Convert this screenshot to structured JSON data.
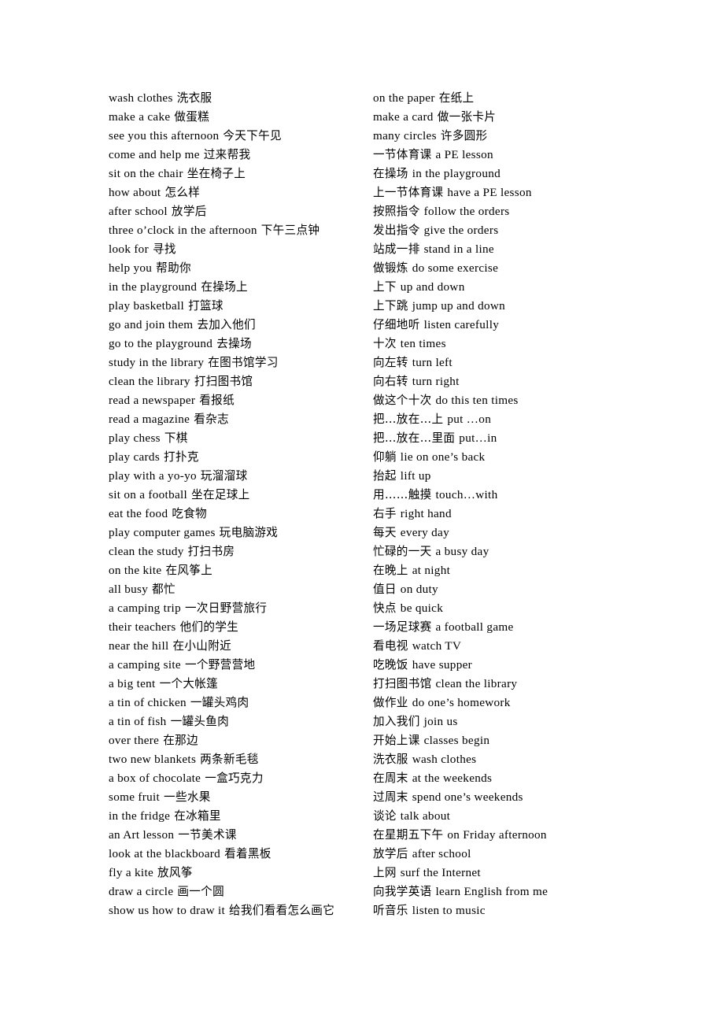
{
  "document": {
    "background_color": "#ffffff",
    "text_color": "#000000",
    "columns": [
      {
        "id": "left-column",
        "order": "english-first",
        "entries": [
          {
            "term": "wash clothes",
            "gloss": "洗衣服"
          },
          {
            "term": "make a cake",
            "gloss": "做蛋糕"
          },
          {
            "term": "see you this afternoon",
            "gloss": "今天下午见"
          },
          {
            "term": "come and help me",
            "gloss": "过来帮我"
          },
          {
            "term": "sit on the chair",
            "gloss": "坐在椅子上"
          },
          {
            "term": "how about",
            "gloss": "怎么样"
          },
          {
            "term": "after school",
            "gloss": "放学后"
          },
          {
            "term": "three o’clock in the afternoon",
            "gloss": "下午三点钟"
          },
          {
            "term": "look for",
            "gloss": "寻找"
          },
          {
            "term": "help you",
            "gloss": "帮助你"
          },
          {
            "term": "in the playground",
            "gloss": "在操场上"
          },
          {
            "term": "play basketball",
            "gloss": "打篮球"
          },
          {
            "term": "go and join them",
            "gloss": "去加入他们"
          },
          {
            "term": "go to the playground",
            "gloss": "去操场"
          },
          {
            "term": "study in the library",
            "gloss": "在图书馆学习"
          },
          {
            "term": "clean the library",
            "gloss": "打扫图书馆"
          },
          {
            "term": "read a newspaper",
            "gloss": "看报纸"
          },
          {
            "term": "read a magazine",
            "gloss": "看杂志"
          },
          {
            "term": "play chess",
            "gloss": "下棋"
          },
          {
            "term": "play cards",
            "gloss": "打扑克"
          },
          {
            "term": "play with a yo-yo",
            "gloss": "玩溜溜球"
          },
          {
            "term": "sit on a football",
            "gloss": "坐在足球上"
          },
          {
            "term": "eat the food",
            "gloss": "吃食物"
          },
          {
            "term": "play computer games",
            "gloss": "玩电脑游戏"
          },
          {
            "term": "clean the study",
            "gloss": "打扫书房"
          },
          {
            "term": "on the kite",
            "gloss": "在风筝上"
          },
          {
            "term": "all busy",
            "gloss": "都忙"
          },
          {
            "term": "a camping trip",
            "gloss": "一次日野营旅行"
          },
          {
            "term": "their teachers",
            "gloss": "他们的学生"
          },
          {
            "term": "near the hill",
            "gloss": "在小山附近"
          },
          {
            "term": "a camping site",
            "gloss": "一个野营营地"
          },
          {
            "term": "a big tent",
            "gloss": "一个大帐篷"
          },
          {
            "term": "a tin of chicken",
            "gloss": "一罐头鸡肉"
          },
          {
            "term": "a tin of fish",
            "gloss": "一罐头鱼肉"
          },
          {
            "term": "over there",
            "gloss": "在那边"
          },
          {
            "term": "two new blankets",
            "gloss": "两条新毛毯"
          },
          {
            "term": "a box of chocolate",
            "gloss": "一盒巧克力"
          },
          {
            "term": "some fruit",
            "gloss": "一些水果"
          },
          {
            "term": "in the fridge",
            "gloss": "在冰箱里"
          },
          {
            "term": "an Art lesson",
            "gloss": "一节美术课"
          },
          {
            "term": "look at the blackboard",
            "gloss": "看着黑板"
          },
          {
            "term": "fly a kite",
            "gloss": "放风筝"
          },
          {
            "term": "draw a circle",
            "gloss": "画一个圆"
          },
          {
            "term": "show us how to draw it",
            "gloss": "给我们看看怎么画它"
          }
        ]
      },
      {
        "id": "right-column",
        "order": "mixed",
        "entries": [
          {
            "term": "on the paper",
            "gloss": "在纸上",
            "cn_first": false
          },
          {
            "term": "make a card",
            "gloss": "做一张卡片",
            "cn_first": false
          },
          {
            "term": "many circles",
            "gloss": "许多圆形",
            "cn_first": false
          },
          {
            "term": "一节体育课",
            "gloss": "a PE lesson",
            "cn_first": true
          },
          {
            "term": "在操场",
            "gloss": "in the playground",
            "cn_first": true
          },
          {
            "term": "上一节体育课",
            "gloss": "have a PE lesson",
            "cn_first": true
          },
          {
            "term": "按照指令",
            "gloss": "follow the orders",
            "cn_first": true
          },
          {
            "term": "发出指令",
            "gloss": "give the orders",
            "cn_first": true
          },
          {
            "term": "站成一排",
            "gloss": "stand in a line",
            "cn_first": true
          },
          {
            "term": "做锻炼",
            "gloss": "do some exercise",
            "cn_first": true
          },
          {
            "term": "上下",
            "gloss": "up and down",
            "cn_first": true
          },
          {
            "term": "上下跳",
            "gloss": "jump up and down",
            "cn_first": true
          },
          {
            "term": "仔细地听",
            "gloss": "listen carefully",
            "cn_first": true
          },
          {
            "term": "十次",
            "gloss": "ten times",
            "cn_first": true
          },
          {
            "term": "向左转",
            "gloss": "turn left",
            "cn_first": true
          },
          {
            "term": "向右转",
            "gloss": "turn right",
            "cn_first": true
          },
          {
            "term": "做这个十次",
            "gloss": "do this ten times",
            "cn_first": true
          },
          {
            "term": "把…放在…上",
            "gloss": "put …on",
            "cn_first": true
          },
          {
            "term": "把…放在…里面",
            "gloss": "put…in",
            "cn_first": true
          },
          {
            "term": "仰躺",
            "gloss": "lie on one’s back",
            "cn_first": true
          },
          {
            "term": "抬起",
            "gloss": "lift up",
            "cn_first": true
          },
          {
            "term": "用……触摸",
            "gloss": "touch…with",
            "cn_first": true
          },
          {
            "term": "右手",
            "gloss": "right hand",
            "cn_first": true
          },
          {
            "term": "每天",
            "gloss": "every day",
            "cn_first": true
          },
          {
            "term": "忙碌的一天",
            "gloss": "a busy day",
            "cn_first": true
          },
          {
            "term": "在晚上",
            "gloss": "at night",
            "cn_first": true
          },
          {
            "term": "值日",
            "gloss": "on duty",
            "cn_first": true
          },
          {
            "term": "快点",
            "gloss": "be quick",
            "cn_first": true
          },
          {
            "term": "一场足球赛",
            "gloss": "a football game",
            "cn_first": true
          },
          {
            "term": "看电视",
            "gloss": "watch TV",
            "cn_first": true
          },
          {
            "term": "吃晚饭",
            "gloss": "have supper",
            "cn_first": true
          },
          {
            "term": "打扫图书馆",
            "gloss": "clean the library",
            "cn_first": true
          },
          {
            "term": "做作业",
            "gloss": "do one’s homework",
            "cn_first": true
          },
          {
            "term": "加入我们",
            "gloss": "join us",
            "cn_first": true
          },
          {
            "term": "开始上课",
            "gloss": "classes begin",
            "cn_first": true
          },
          {
            "term": "洗衣服",
            "gloss": "wash clothes",
            "cn_first": true
          },
          {
            "term": "在周末",
            "gloss": "at the weekends",
            "cn_first": true
          },
          {
            "term": "过周末",
            "gloss": "spend one’s weekends",
            "cn_first": true
          },
          {
            "term": "谈论",
            "gloss": "talk about",
            "cn_first": true
          },
          {
            "term": "在星期五下午",
            "gloss": "on Friday afternoon",
            "cn_first": true
          },
          {
            "term": "放学后",
            "gloss": "after school",
            "cn_first": true
          },
          {
            "term": "上网",
            "gloss": "surf  the Internet",
            "cn_first": true
          },
          {
            "term": "向我学英语",
            "gloss": "learn English from me",
            "cn_first": true
          },
          {
            "term": "听音乐",
            "gloss": "listen to music",
            "cn_first": true
          }
        ]
      }
    ]
  }
}
